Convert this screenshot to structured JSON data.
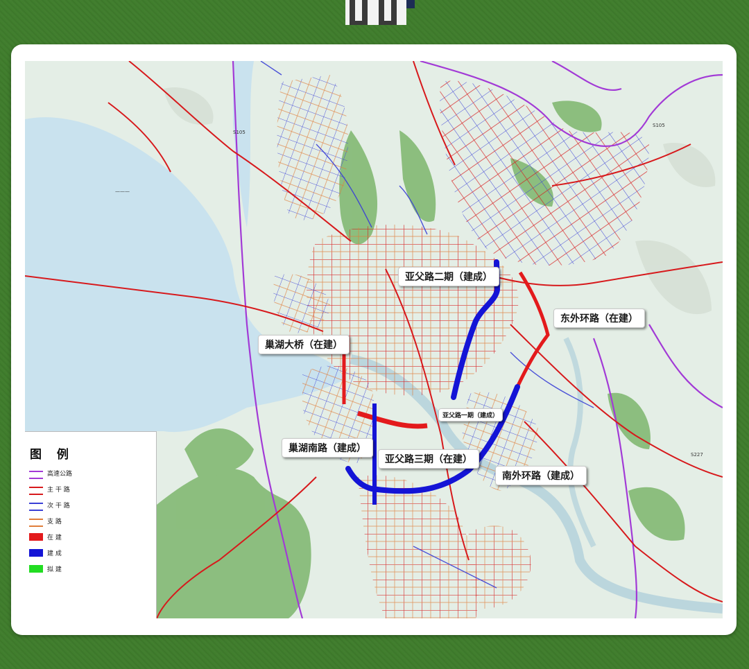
{
  "map": {
    "callouts": {
      "yafu2": "亚父路二期（建成）",
      "dongwai": "东外环路（在建）",
      "chaohu_bridge": "巢湖大桥（在建）",
      "yafu1": "亚父路一期（建成）",
      "chaohu_south": "巢湖南路（建成）",
      "yafu3": "亚父路三期（在建）",
      "nanhuan": "南外环路（建成）"
    },
    "colors": {
      "lake": "#c9e2ee",
      "land": "#e4eee6",
      "mountain": "#6fae5c",
      "expressway": "#a23ad6",
      "trunk_road": "#d7191c",
      "secondary_road": "#3a3fd6",
      "branch_road": "#e07d3a",
      "in_construction": "#e31a1c",
      "built": "#1414d6",
      "planned": "#22dd22"
    }
  },
  "legend": {
    "title": "图 例",
    "items": [
      {
        "label": "高速公路",
        "color": "#a23ad6",
        "style": "road"
      },
      {
        "label": "主 干 路",
        "color": "#d7191c",
        "style": "road"
      },
      {
        "label": "次 干 路",
        "color": "#3a3fd6",
        "style": "road"
      },
      {
        "label": "支    路",
        "color": "#e07d3a",
        "style": "road"
      },
      {
        "label": "在    建",
        "color": "#e31a1c",
        "style": "box"
      },
      {
        "label": "建    成",
        "color": "#1414d6",
        "style": "box"
      },
      {
        "label": "拟    建",
        "color": "#22dd22",
        "style": "box"
      }
    ]
  }
}
